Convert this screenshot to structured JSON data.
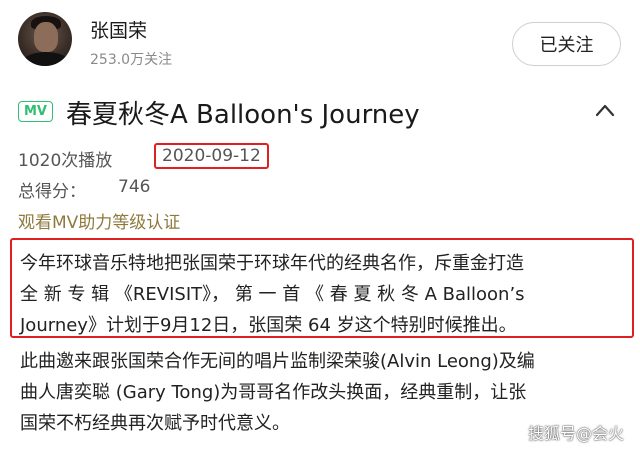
{
  "header": {
    "name": "张国荣",
    "followers": "253.0万关注",
    "follow_button": "已关注"
  },
  "video": {
    "badge": "MV",
    "title": "春夏秋冬A Balloon's Journey",
    "plays": "1020次播放",
    "date": "2020-09-12",
    "score_label": "总得分：",
    "score_value": "746",
    "cert_link": "观看MV助力等级认证"
  },
  "description": {
    "highlighted_lines": [
      "今年环球音乐特地把张国荣于环球年代的经典名作，斥重金打造",
      "全 新 专 辑  《REVISIT》， 第 一 首 《 春 夏 秋 冬 A  Balloon’s",
      "Journey》计划于9月12日，张国荣 64 岁这个特别时候推出。"
    ],
    "lines": [
      "此曲邀来跟张国荣合作无间的唱片监制梁荣骏(Alvin Leong)及编",
      "曲人唐奕聪 (Gary Tong)为哥哥名作改头换面，经典重制，让张",
      "国荣不朽经典再次赋予时代意义。"
    ]
  },
  "watermark": "搜狐号@会火",
  "colors": {
    "badge_green": "#2fbf71",
    "highlight_red": "#e02020",
    "link_gold": "#8f7a3e"
  },
  "icons": [
    "avatar",
    "chevron-up-icon"
  ]
}
